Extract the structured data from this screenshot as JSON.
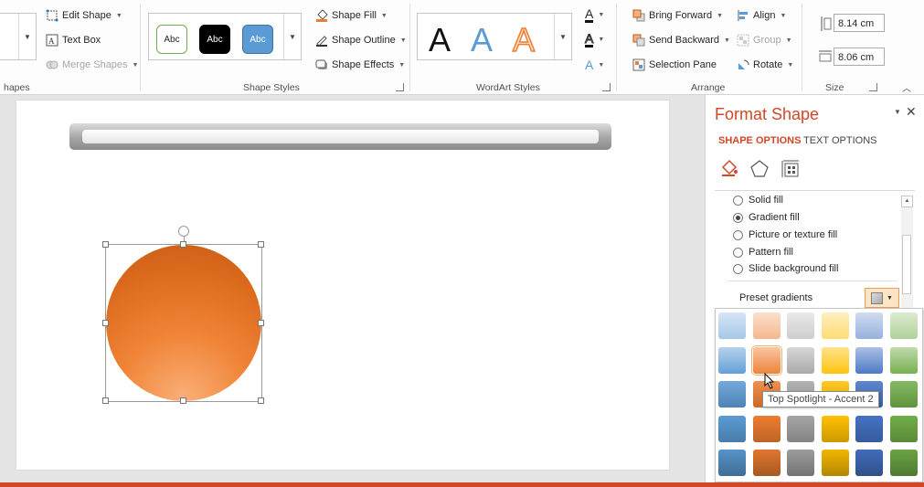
{
  "ribbon": {
    "insert_shapes": {
      "group_label": "hapes",
      "edit_shape": "Edit Shape",
      "text_box": "Text Box",
      "merge_shapes": "Merge Shapes"
    },
    "shape_styles": {
      "group_label": "Shape Styles",
      "tiles": [
        {
          "label": "Abc",
          "fill": "#ffffff",
          "border": "#70ad47",
          "text": "#262626"
        },
        {
          "label": "Abc",
          "fill": "#000000",
          "border": "#000000",
          "text": "#ffffff"
        },
        {
          "label": "Abc",
          "fill": "#5b9bd5",
          "border": "#41719c",
          "text": "#ffffff"
        }
      ],
      "shape_fill": "Shape Fill",
      "shape_outline": "Shape Outline",
      "shape_effects": "Shape Effects"
    },
    "wordart": {
      "group_label": "WordArt Styles",
      "letters": [
        {
          "label": "A",
          "color": "#111111"
        },
        {
          "label": "A",
          "color": "#5b9bd5"
        },
        {
          "label": "A",
          "color": "#fbe0c8"
        }
      ],
      "small_letters": [
        "A",
        "A",
        "A"
      ]
    },
    "arrange": {
      "group_label": "Arrange",
      "bring_forward": "Bring Forward",
      "send_backward": "Send Backward",
      "selection_pane": "Selection Pane",
      "align": "Align",
      "group": "Group",
      "rotate": "Rotate"
    },
    "size": {
      "group_label": "Size",
      "height": "8.14 cm",
      "width": "8.06 cm"
    }
  },
  "format_pane": {
    "title": "Format Shape",
    "tab_shape_options": "SHAPE OPTIONS",
    "tab_text_options": "TEXT OPTIONS",
    "fill_options": [
      {
        "label": "Solid fill",
        "checked": false
      },
      {
        "label": "Gradient fill",
        "checked": true
      },
      {
        "label": "Picture or texture fill",
        "checked": false
      },
      {
        "label": "Pattern fill",
        "checked": false
      },
      {
        "label": "Slide background fill",
        "checked": false
      }
    ],
    "preset_gradients_label": "Preset gradients",
    "tooltip": "Top Spotlight - Accent 2"
  },
  "gradient_palette": {
    "columns": [
      "#5b9bd5",
      "#ed7d31",
      "#a5a5a5",
      "#ffc000",
      "#4472c4",
      "#70ad47"
    ],
    "hover_row": 1,
    "hover_col": 1
  },
  "colors": {
    "accent": "#d24726",
    "shape_orange": "#ed7d31"
  }
}
